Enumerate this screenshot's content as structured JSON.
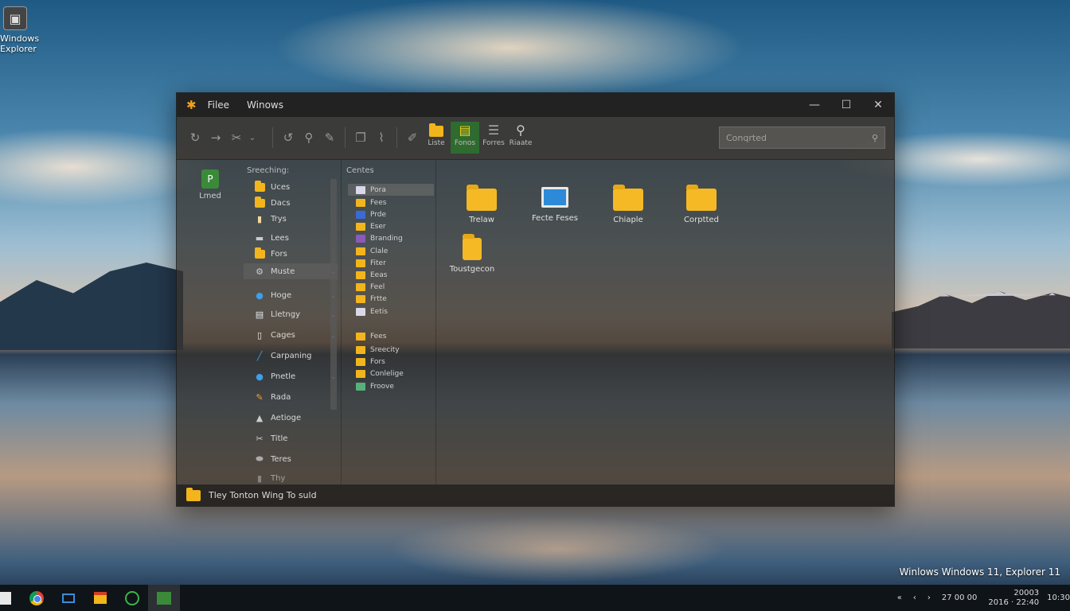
{
  "desktop": {
    "icon_label": "Windows\nExplorer",
    "watermark": "Winlows Windows 11, Explorer 11"
  },
  "window": {
    "menu": [
      "Filee",
      "Winows"
    ],
    "controls": {
      "minimize": "—",
      "maximize": "☐",
      "close": "✕"
    }
  },
  "toolbar": {
    "big_buttons": [
      "Liste",
      "Fonos",
      "Forres",
      "Riaate"
    ],
    "search_placeholder": "Conqrted"
  },
  "left_pane": {
    "item_label": "Lmed"
  },
  "nav_pane": {
    "header": "Sreeching:",
    "items": [
      {
        "label": "Uces",
        "icon": "folder-icon"
      },
      {
        "label": "Dacs",
        "icon": "folder-icon"
      },
      {
        "label": "Trys",
        "icon": "document-icon"
      },
      {
        "label": "Lees",
        "icon": "drive-icon"
      },
      {
        "label": "Fors",
        "icon": "folder-icon"
      },
      {
        "label": "Muste",
        "icon": "settings-icon"
      },
      {
        "label": "Hoge",
        "icon": "globe-icon"
      },
      {
        "label": "Lletngy",
        "icon": "document-icon"
      },
      {
        "label": "Cages",
        "icon": "document-icon"
      },
      {
        "label": "Carpaning",
        "icon": "pen-icon"
      },
      {
        "label": "Pnetle",
        "icon": "globe-icon"
      },
      {
        "label": "Rada",
        "icon": "pencil-icon"
      },
      {
        "label": "Aetioge",
        "icon": "triangle-icon"
      },
      {
        "label": "Title",
        "icon": "tool-icon"
      },
      {
        "label": "Teres",
        "icon": "drive-icon"
      },
      {
        "label": "Thy",
        "icon": "drive-icon"
      }
    ]
  },
  "tree_pane": {
    "header": "Centes",
    "items": [
      {
        "label": "Pora",
        "icon": "doc"
      },
      {
        "label": "Fees",
        "icon": "folder"
      },
      {
        "label": "Prde",
        "icon": "blue"
      },
      {
        "label": "Eser",
        "icon": "folder"
      },
      {
        "label": "Branding",
        "icon": "purple"
      },
      {
        "label": "Clale",
        "icon": "folder"
      },
      {
        "label": "Fiter",
        "icon": "folder"
      },
      {
        "label": "Eeas",
        "icon": "folder"
      },
      {
        "label": "Feel",
        "icon": "folder"
      },
      {
        "label": "Frtte",
        "icon": "folder"
      },
      {
        "label": "Eetis",
        "icon": "doc"
      },
      {
        "label": "Fees",
        "icon": "folder"
      },
      {
        "label": "Sreecity",
        "icon": "folder"
      },
      {
        "label": "Fors",
        "icon": "folder"
      },
      {
        "label": "Conlelige",
        "icon": "folder"
      },
      {
        "label": "Froove",
        "icon": "green"
      }
    ]
  },
  "content": {
    "items": [
      {
        "label": "Trelaw",
        "type": "folder"
      },
      {
        "label": "Fecte Feses",
        "type": "monitor"
      },
      {
        "label": "Chiaple",
        "type": "folder"
      },
      {
        "label": "Corptted",
        "type": "folder"
      },
      {
        "label": "Toustgecon",
        "type": "folder-doc"
      }
    ]
  },
  "status": {
    "text": "Tley Tonton Wing To suld"
  },
  "taskbar": {
    "tray_icons": [
      "«",
      "‹",
      "›"
    ],
    "tray_text": "27 00 00",
    "time_line1": "20003",
    "time_line2": "2016 · 22:40",
    "clock_top": "10:30"
  }
}
